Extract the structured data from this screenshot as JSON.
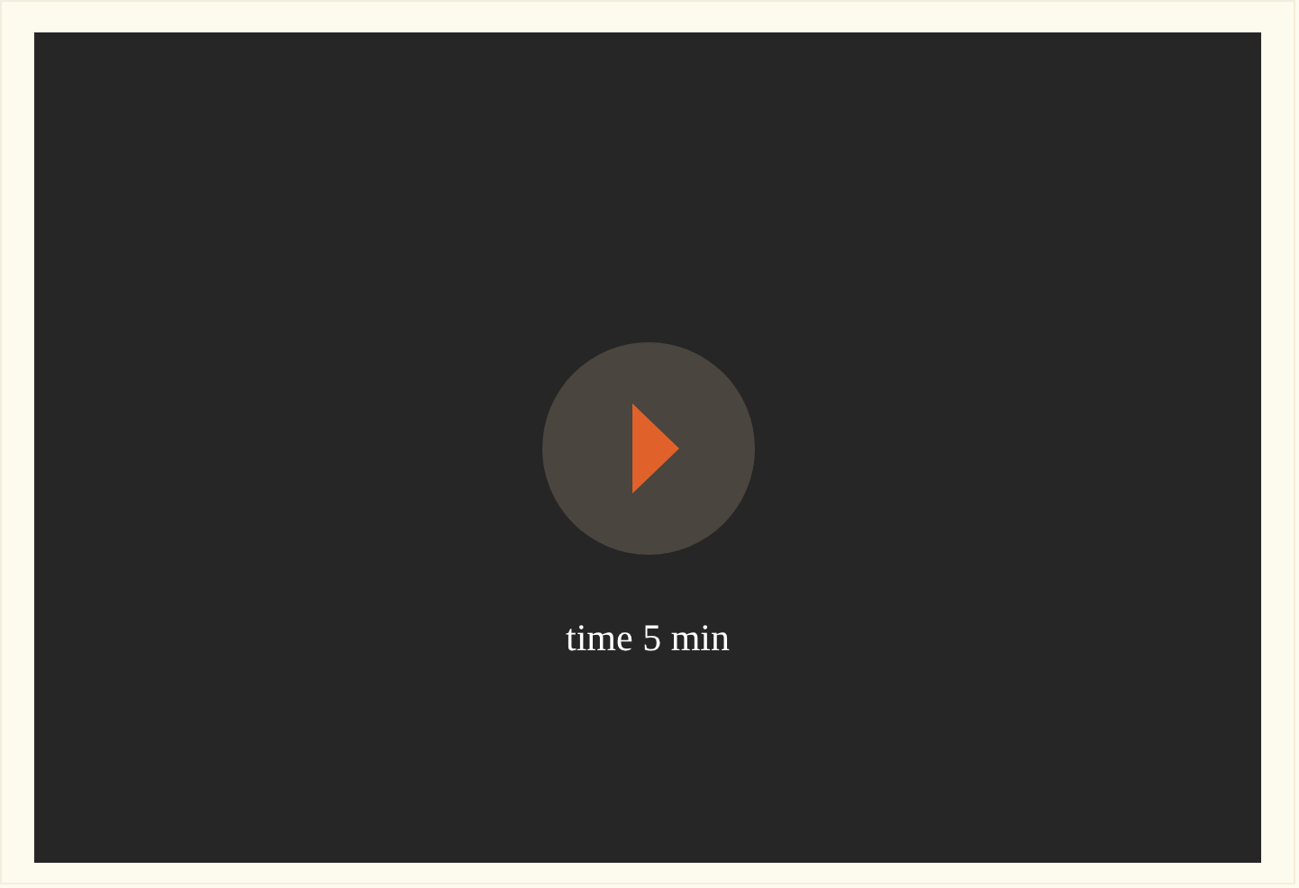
{
  "video": {
    "caption": "time 5 min"
  }
}
